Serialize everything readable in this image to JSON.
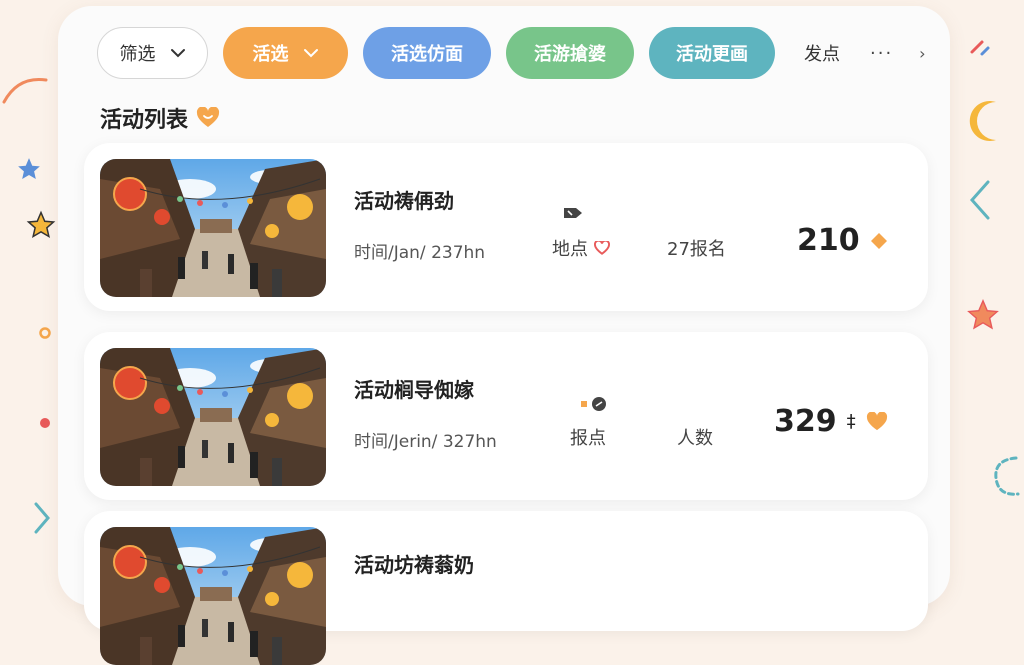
{
  "filters": {
    "filter_label": "筛选",
    "chips": [
      "活选",
      "活选仿面",
      "活游搶婆",
      "活动更画"
    ],
    "text_item": "发点",
    "more": "···",
    "more_chevron": "›"
  },
  "section": {
    "title": "活动列表"
  },
  "events": [
    {
      "title": "活动祷侢劲",
      "time": "时间/Jan/ 237hn",
      "location": "地点",
      "signup": "27报名",
      "count": "210"
    },
    {
      "title": "活动榈导倁嫁",
      "time": "时间/Jerin/ 327hn",
      "location": "报点",
      "people": "人数",
      "count": "329",
      "count_mark": "‡"
    },
    {
      "title": "活动坊祷蓊奶"
    }
  ],
  "colors": {
    "orange": "#f5a64c",
    "blue": "#6ea0e6",
    "green": "#78c58a",
    "teal": "#5eb4bf",
    "background": "#fbf2ea"
  },
  "icons": [
    "chevron-down-icon",
    "heart-icon",
    "diamond-icon",
    "location-pin-icon",
    "speaker-icon",
    "star-icon",
    "moon-icon"
  ]
}
